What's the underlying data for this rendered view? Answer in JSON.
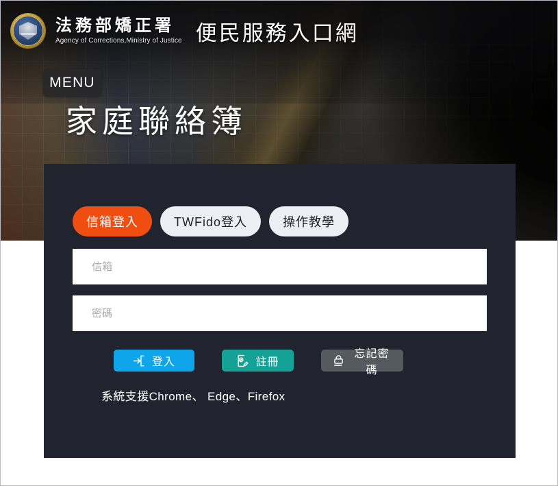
{
  "header": {
    "logo_icon": "agency-seal-icon",
    "brand_cn": "法務部矯正署",
    "brand_en": "Agency of Corrections,Ministry of Justice",
    "site_title": "便民服務入口網"
  },
  "nav": {
    "menu_label": "MENU"
  },
  "hero": {
    "page_title": "家庭聯絡簿"
  },
  "login": {
    "tabs": [
      {
        "label": "信箱登入",
        "active": true
      },
      {
        "label": "TWFido登入",
        "active": false
      },
      {
        "label": "操作教學",
        "active": false
      }
    ],
    "email": {
      "placeholder": "信箱",
      "value": ""
    },
    "password": {
      "placeholder": "密碼",
      "value": ""
    },
    "buttons": {
      "login": {
        "label": "登入",
        "icon": "login-arrow-icon",
        "color": "#0ea5ea"
      },
      "register": {
        "label": "註冊",
        "icon": "document-pencil-icon",
        "color": "#13a295"
      },
      "forgot": {
        "label": "忘記密碼",
        "icon": "padlock-asterisks-icon",
        "color": "#555a5e"
      }
    },
    "support_note": "系統支援Chrome、 Edge、Firefox"
  },
  "colors": {
    "accent_orange": "#f04e11",
    "panel_dark": "#21242e",
    "login_blue": "#0ea5ea",
    "register_teal": "#13a295",
    "forgot_gray": "#555a5e",
    "tab_idle": "#eceff3"
  }
}
